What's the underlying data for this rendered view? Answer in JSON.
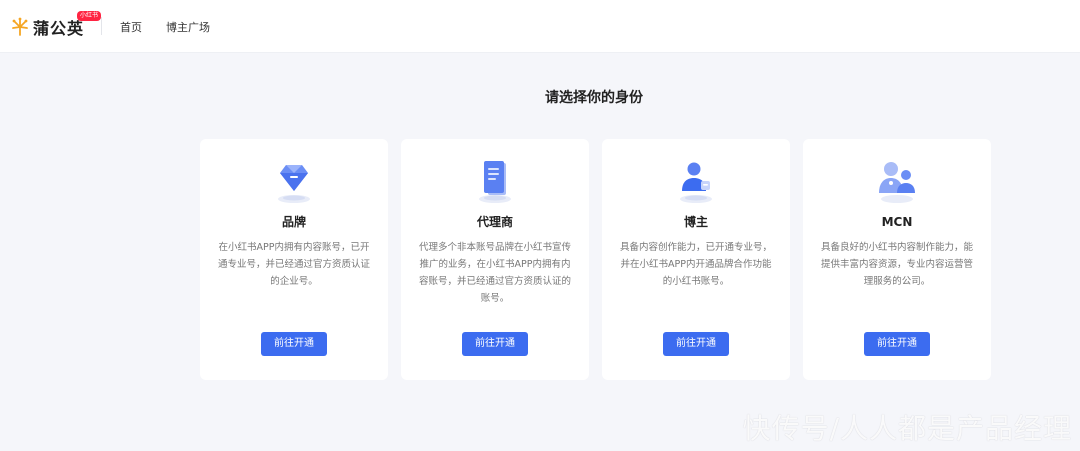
{
  "header": {
    "logo_text": "蒲公英",
    "logo_badge": "小红书",
    "nav": [
      "首页",
      "博主广场"
    ]
  },
  "title": "请选择你的身份",
  "cards": [
    {
      "title": "品牌",
      "icon": "diamond-icon",
      "description": "在小红书APP内拥有内容账号，已开通专业号，并已经通过官方资质认证的企业号。",
      "button": "前往开通"
    },
    {
      "title": "代理商",
      "icon": "document-icon",
      "description": "代理多个非本账号品牌在小红书宣传推广的业务，在小红书APP内拥有内容账号，并已经通过官方资质认证的账号。",
      "button": "前往开通"
    },
    {
      "title": "博主",
      "icon": "user-icon",
      "description": "具备内容创作能力，已开通专业号，并在小红书APP内开通品牌合作功能的小红书账号。",
      "button": "前往开通"
    },
    {
      "title": "MCN",
      "icon": "group-icon",
      "description": "具备良好的小红书内容制作能力，能提供丰富内容资源，专业内容运营管理服务的公司。",
      "button": "前往开通"
    }
  ],
  "watermark": "快传号/人人都是产品经理",
  "colors": {
    "accent": "#3c6cf0",
    "background": "#f5f6fa",
    "logo_orange": "#f5a623",
    "badge_red": "#ff2442"
  }
}
